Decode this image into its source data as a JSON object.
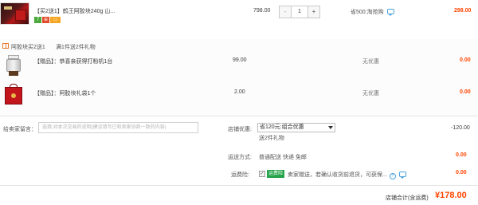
{
  "product": {
    "title": "【买2送1】鹤王阿胶块240g 山...",
    "badges": [
      "7",
      "⊕",
      "▭"
    ],
    "unit_price": "798.00",
    "quantity": "1",
    "qty_minus": "-",
    "qty_plus": "+",
    "save_note": "省500:淘抢购",
    "subtotal": "298.00"
  },
  "promo": {
    "name": "阿胶块买2送1",
    "rule": "满1件送2件礼物",
    "gifts": [
      {
        "title": "【赠品】：恭喜亲获得打粉机1台",
        "price": "99.00",
        "discount": "无优惠",
        "total": "0.00"
      },
      {
        "title": "【赠品】：阿胶块礼袋1个",
        "price": "2.00",
        "discount": "无优惠",
        "total": "0.00"
      }
    ]
  },
  "order": {
    "message_label": "给卖家留言：",
    "message_placeholder": "选填:对本次交易的说明(建议填写已和卖家协商一致的内容)",
    "shop_discount_label": "店铺优惠:",
    "shop_discount_selected": "省120元:组合优惠",
    "shop_discount_sub": "送2件礼物",
    "shop_discount_amount": "-120.00",
    "shipping_label": "运送方式:",
    "shipping_value": "普通配送 快递 免邮",
    "shipping_amount": "0.00",
    "insurance_label": "运费险:",
    "insurance_check": "✓",
    "insurance_badge": "运费险",
    "insurance_text": "卖家赠送，若确认收货前退货，可获保...",
    "insurance_help": "?",
    "insurance_amount": "0.00",
    "total_label": "店铺合计(含运费)",
    "total_amount": "¥178.00"
  },
  "colors": {
    "price_red": "#ff4400",
    "green_badge": "#25a34a",
    "link_blue": "#4aa3df"
  },
  "icons": [
    "product-thumbnail",
    "chat-icon",
    "gift-icon",
    "dropdown-caret-icon",
    "help-icon"
  ]
}
